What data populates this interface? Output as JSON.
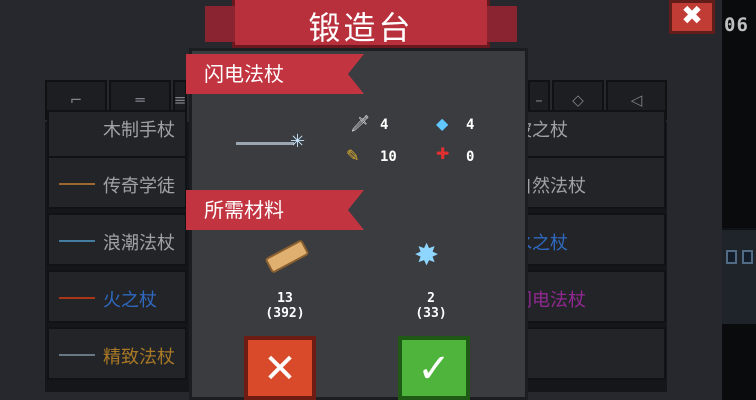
{
  "header": {
    "title": "锻造台",
    "close_glyph": "✖",
    "counter": "06"
  },
  "tabs": [
    {
      "icon": "gun-icon",
      "glyph": "⌐"
    },
    {
      "icon": "rifle-icon",
      "glyph": "═"
    },
    {
      "icon": "weapon-icon",
      "glyph": "≡"
    },
    {
      "icon": "weapon-icon",
      "glyph": "–"
    },
    {
      "icon": "crosshair-icon",
      "glyph": "◇"
    },
    {
      "icon": "fish-icon",
      "glyph": "◁"
    }
  ],
  "recipes": [
    {
      "label": "木制手杖",
      "color": "#d6d8dc"
    },
    {
      "label": "传奇学徒",
      "color": "#d6d8dc"
    },
    {
      "label": "浪潮法杖",
      "color": "#d6d8dc"
    },
    {
      "label": "火之杖",
      "color": "#3f8cff"
    },
    {
      "label": "精致法杖",
      "color": "#e0a030"
    },
    {
      "label": "波之杖",
      "color": "#d6d8dc"
    },
    {
      "label": "自然法杖",
      "color": "#d6d8dc"
    },
    {
      "label": "水之杖",
      "color": "#3f8cff"
    },
    {
      "label": "闪电法杖",
      "color": "#c236c2"
    }
  ],
  "dialog": {
    "weapon_name": "闪电法杖",
    "stats": {
      "damage": "4",
      "energy": "4",
      "crit": "10",
      "spread": "0"
    },
    "materials_title": "所需材料",
    "materials": [
      {
        "icon": "wood-icon",
        "amount": "13",
        "stock": "(392)"
      },
      {
        "icon": "crystal-shard-icon",
        "amount": "2",
        "stock": "(33)"
      }
    ],
    "cancel_glyph": "✕",
    "confirm_glyph": "✓"
  },
  "colors": {
    "accent_red": "#c13440",
    "cancel": "#d84a2a",
    "confirm": "#4fb43c",
    "legend_blue": "#3f8cff",
    "epic_purple": "#c236c2",
    "rare_orange": "#e0a030"
  }
}
